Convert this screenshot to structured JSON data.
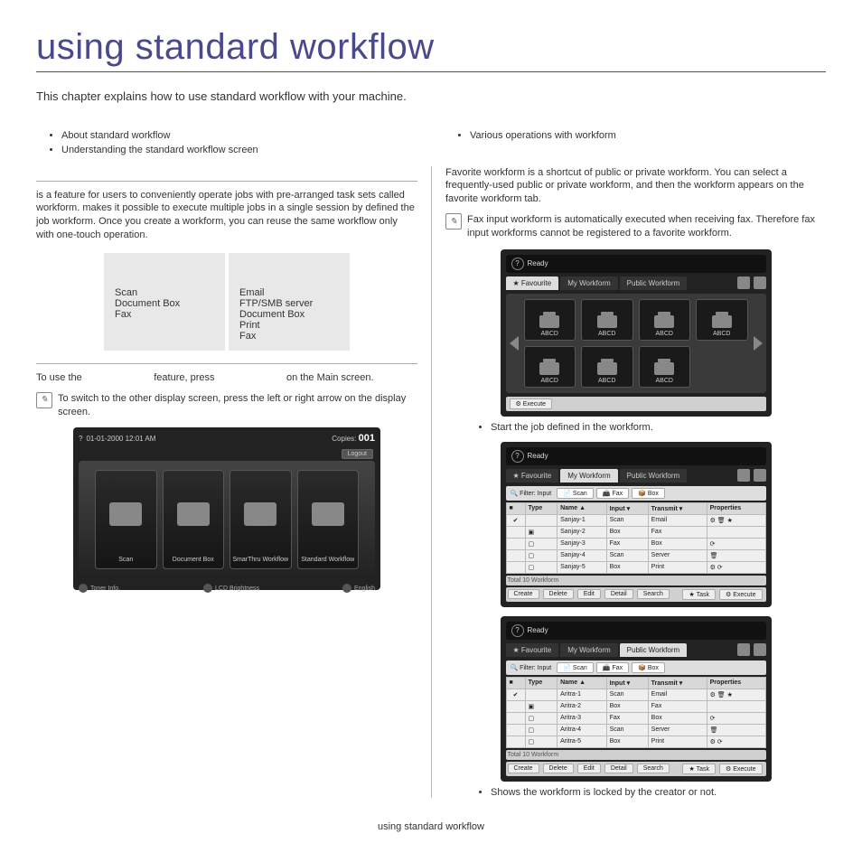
{
  "title": "using standard workflow",
  "intro": "This chapter explains how to use standard workflow with your machine.",
  "topics_left": [
    "About standard workflow",
    "Understanding the standard workflow screen"
  ],
  "topics_right": [
    "Various operations with workform"
  ],
  "left": {
    "about_p1_prefix": "",
    "about_p1": " is a feature for users to conveniently operate jobs with pre-arranged task sets called workform. ",
    "about_p1_mid": "",
    "about_p1_b": " makes it possible to execute multiple jobs in a single session by defined the job workform. Once you create a workform, you can reuse the same workflow only with one-touch operation.",
    "table": {
      "col1": [
        "Scan",
        "Document Box",
        "Fax"
      ],
      "col2": [
        "Email",
        "FTP/SMB server",
        "Document Box",
        "Print",
        "Fax"
      ]
    },
    "use_line_a": "To use the ",
    "use_line_b": " feature, press ",
    "use_line_c": " on the Main screen.",
    "note1": "To switch to the other display screen, press the left or right arrow on the display screen.",
    "main_screen": {
      "time": "01-01-2000  12:01 AM",
      "copies_label": "Copies:",
      "copies_value": "001",
      "logout": "Logout",
      "tiles": [
        "Scan",
        "Document Box",
        "SmarThru Workflow",
        "Standard Workflow"
      ],
      "footer": {
        "toner": "Toner Info.",
        "lcd": "LCD Brightness",
        "lang": "English"
      }
    }
  },
  "right": {
    "fav_p": "Favorite workform is a shortcut of public or private workform. You can select a frequently-used public or private workform, and then the workform appears on the favorite workform tab.",
    "note2": "Fax input workform is automatically executed when receiving fax. Therefore fax input workforms cannot be registered to a favorite workform.",
    "fav_shot": {
      "status": "Ready",
      "tabs": [
        "Favourite",
        "My Workform",
        "Public Workform"
      ],
      "tile_label": "ABCD",
      "execute": "Execute"
    },
    "caption1": "Start the job defined in the workform.",
    "list_shot": {
      "status": "Ready",
      "tabs": [
        "Favourite",
        "My Workform",
        "Public Workform"
      ],
      "filter_label": "Filter: Input",
      "chips": [
        "Scan",
        "Fax",
        "Box"
      ],
      "headers": [
        "",
        "Type",
        "Name",
        "Input",
        "Transmit",
        "Properties"
      ],
      "rows1": [
        {
          "chk": "✔",
          "type": "",
          "name": "Sanjay-1",
          "in": "Scan",
          "tr": "Email",
          "pr": "⚙ 🗑 ★"
        },
        {
          "chk": "",
          "type": "▣",
          "name": "Sanjay-2",
          "in": "Box",
          "tr": "Fax",
          "pr": ""
        },
        {
          "chk": "",
          "type": "▢",
          "name": "Sanjay-3",
          "in": "Fax",
          "tr": "Box",
          "pr": "⟳"
        },
        {
          "chk": "",
          "type": "▢",
          "name": "Sanjay-4",
          "in": "Scan",
          "tr": "Server",
          "pr": "🗑"
        },
        {
          "chk": "",
          "type": "▢",
          "name": "Sanjay-5",
          "in": "Box",
          "tr": "Print",
          "pr": "⚙ ⟳"
        }
      ],
      "rows2": [
        {
          "chk": "✔",
          "type": "",
          "name": "Aritra-1",
          "in": "Scan",
          "tr": "Email",
          "pr": "⚙ 🗑 ★"
        },
        {
          "chk": "",
          "type": "▣",
          "name": "Aritra-2",
          "in": "Box",
          "tr": "Fax",
          "pr": ""
        },
        {
          "chk": "",
          "type": "▢",
          "name": "Aritra-3",
          "in": "Fax",
          "tr": "Box",
          "pr": "⟳"
        },
        {
          "chk": "",
          "type": "▢",
          "name": "Aritra-4",
          "in": "Scan",
          "tr": "Server",
          "pr": "🗑"
        },
        {
          "chk": "",
          "type": "▢",
          "name": "Aritra-5",
          "in": "Box",
          "tr": "Print",
          "pr": "⚙ ⟳"
        }
      ],
      "total": "Total 10 Workform",
      "buttons": [
        "Create",
        "Delete",
        "Edit",
        "Detail",
        "Search"
      ],
      "right_buttons": [
        "Task",
        "Execute"
      ]
    },
    "caption2": "Shows the workform is locked by the creator or not."
  },
  "footer": "using standard workflow"
}
